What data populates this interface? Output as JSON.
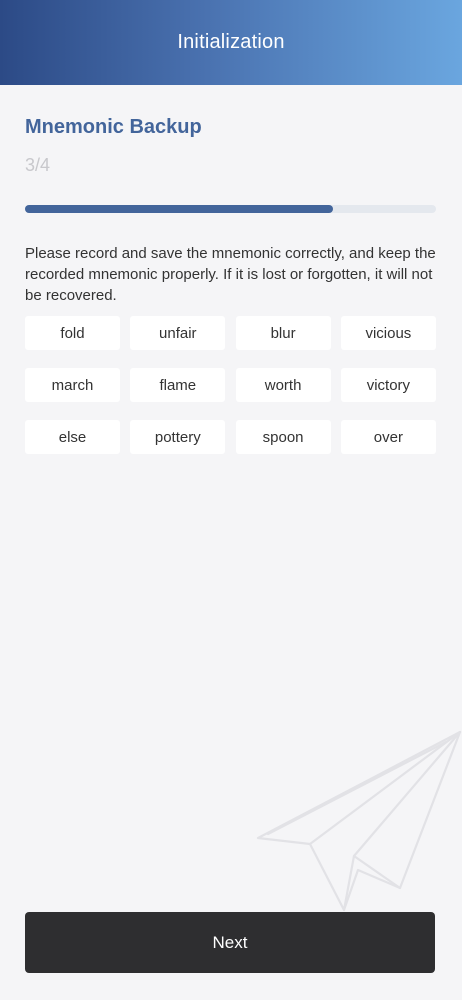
{
  "header": {
    "title": "Initialization"
  },
  "page": {
    "title": "Mnemonic Backup",
    "step": "3/4",
    "progress": 0.75,
    "description": "Please record and save the mnemonic correctly, and keep the recorded mnemonic properly. If it is lost or forgotten, it will not be recovered."
  },
  "mnemonic": {
    "words": [
      "fold",
      "unfair",
      "blur",
      "vicious",
      "march",
      "flame",
      "worth",
      "victory",
      "else",
      "pottery",
      "spoon",
      "over"
    ]
  },
  "footer": {
    "next_label": "Next"
  },
  "colors": {
    "accent": "#43659b",
    "header_gradient_start": "#2c4a86",
    "header_gradient_end": "#6aa6df",
    "button_bg": "#2e2e30",
    "background": "#f5f5f7"
  },
  "icons": {
    "watermark": "paper-plane-icon"
  }
}
